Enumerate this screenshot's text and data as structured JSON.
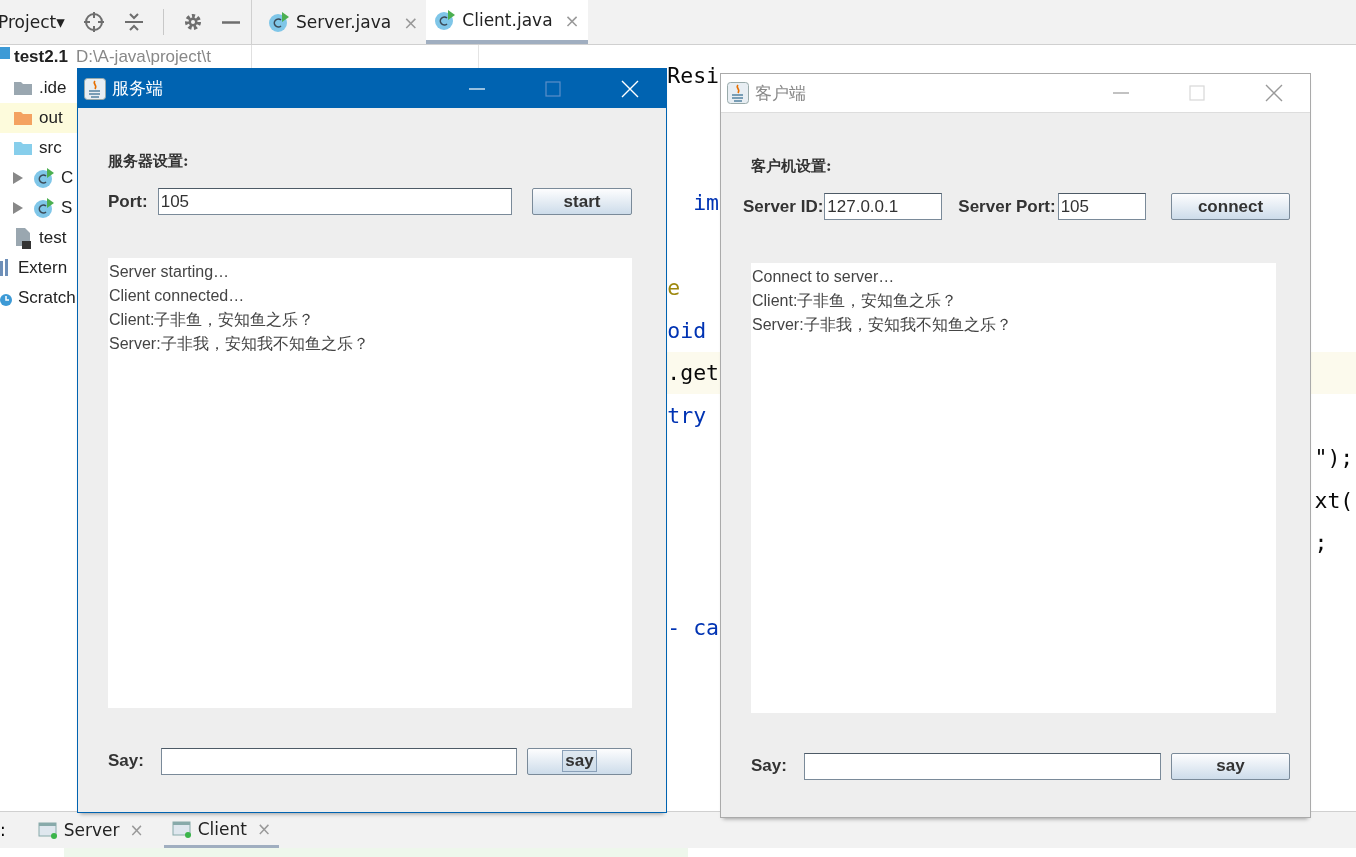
{
  "project_toolbar": {
    "title": "Project▾"
  },
  "editor_tabs": [
    {
      "label": "Server.java",
      "close": "×",
      "selected": false
    },
    {
      "label": "Client.java",
      "close": "×",
      "selected": true
    }
  ],
  "project_tree": [
    {
      "label": "test2.1",
      "path": "D:\\A-java\\project\\t",
      "kind": "module",
      "children": [
        {
          "label": ".ide",
          "kind": "folder"
        },
        {
          "label": "out",
          "kind": "excluded"
        },
        {
          "label": "src",
          "kind": "source"
        },
        {
          "label": "C",
          "kind": "class",
          "expanded": false
        },
        {
          "label": "S",
          "kind": "class",
          "expanded": false
        },
        {
          "label": "test",
          "kind": "file"
        }
      ]
    },
    {
      "label": "Extern",
      "kind": "library"
    },
    {
      "label": "Scratch",
      "kind": "scratch"
    }
  ],
  "code_lines": [
    {
      "text": "             Resi",
      "kind": "plain"
    },
    {
      "text": "               im",
      "kind": "keyword"
    },
    {
      "text": "             e",
      "kind": "annotation"
    },
    {
      "text": "             oid",
      "kind": "keyword"
    },
    {
      "text": "             .get",
      "kind": "plain",
      "current": true
    },
    {
      "text": "             try",
      "kind": "keyword"
    },
    {
      "text": "                                                               \");",
      "kind": "plain"
    },
    {
      "text": "                                                               xt(",
      "kind": "plain"
    },
    {
      "text": "                                                               ;",
      "kind": "plain"
    },
    {
      "text": "             - ca",
      "kind": "keyword"
    }
  ],
  "run_tabs": {
    "prefix": ":",
    "tabs": [
      {
        "label": "Server",
        "close": "×",
        "selected": false
      },
      {
        "label": "Client",
        "close": "×",
        "selected": true
      }
    ]
  },
  "windows": [
    {
      "kind": "server",
      "title": "服务端",
      "active": true,
      "heading": "服务器设置:",
      "fields": [
        {
          "label": "Port:",
          "value": "105"
        }
      ],
      "connect_button": "start",
      "log": [
        "Server starting…",
        "Client connected…",
        "Client:子非鱼，安知鱼之乐？",
        "Server:子非我，安知我不知鱼之乐？"
      ],
      "say_label": "Say:",
      "say_button": {
        "label": "say",
        "focused": true
      }
    },
    {
      "kind": "client",
      "title": "客户端",
      "active": false,
      "heading": "客户机设置:",
      "fields": [
        {
          "label": "Server ID:",
          "value": "127.0.0.1"
        },
        {
          "label": "Server Port:",
          "value": "105"
        }
      ],
      "connect_button": "connect",
      "log": [
        "Connect to server…",
        "Client:子非鱼，安知鱼之乐？",
        "Server:子非我，安知我不知鱼之乐？"
      ],
      "say_label": "Say:",
      "say_button": {
        "label": "say",
        "focused": false
      }
    }
  ]
}
